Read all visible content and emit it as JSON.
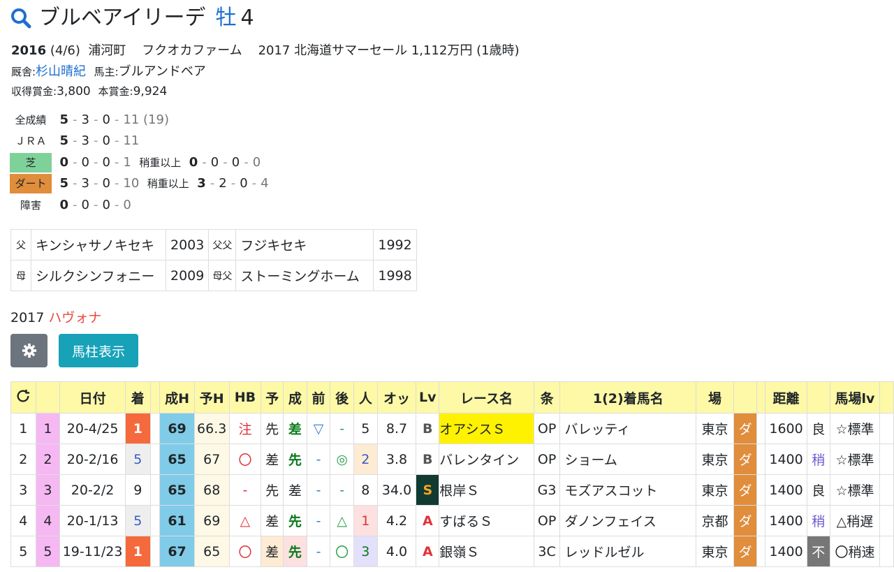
{
  "horse": {
    "name": "ブルベアイリーデ",
    "sex": "牡",
    "age": "4",
    "birth_year": "2016",
    "birth_date": "(4/6)",
    "region": "浦河町",
    "breeder": "フクオカファーム",
    "sale": "2017 北海道サマーセール 1,112万円 (1歳時)",
    "trainer_label": "厩舎:",
    "trainer": "杉山晴紀",
    "owner_label": "馬主:",
    "owner": "ブルアンドベア",
    "earn_label": "収得賞金:",
    "earn": "3,800",
    "prize_label": "本賞金:",
    "prize": "9,924"
  },
  "records": [
    {
      "label": "全成績",
      "a": "5",
      "b": "3",
      "c": "0",
      "d": "11",
      "extra": "(19)",
      "heavy_label": "",
      "ha": "",
      "hb": "",
      "hc": "",
      "hd": ""
    },
    {
      "label": "ＪＲＡ",
      "a": "5",
      "b": "3",
      "c": "0",
      "d": "11",
      "extra": "",
      "heavy_label": "",
      "ha": "",
      "hb": "",
      "hc": "",
      "hd": ""
    },
    {
      "label": "芝",
      "a": "0",
      "b": "0",
      "c": "0",
      "d": "1",
      "extra": "",
      "heavy_label": "稍重以上",
      "ha": "0",
      "hb": "0",
      "hc": "0",
      "hd": "0"
    },
    {
      "label": "ダート",
      "a": "5",
      "b": "3",
      "c": "0",
      "d": "10",
      "extra": "",
      "heavy_label": "稍重以上",
      "ha": "3",
      "hb": "2",
      "hc": "0",
      "hd": "4"
    },
    {
      "label": "障害",
      "a": "0",
      "b": "0",
      "c": "0",
      "d": "0",
      "extra": "",
      "heavy_label": "",
      "ha": "",
      "hb": "",
      "hc": "",
      "hd": ""
    }
  ],
  "pedigree": {
    "sire_k": "父",
    "sire": "キンシャサノキセキ",
    "sire_y": "2003",
    "ss_k": "父父",
    "ss": "フジキセキ",
    "ss_y": "1992",
    "dam_k": "母",
    "dam": "シルクシンフォニー",
    "dam_y": "2009",
    "ds_k": "母父",
    "ds": "ストーミングホーム",
    "ds_y": "1998"
  },
  "progeny": {
    "year": "2017",
    "name": "ハヴォナ"
  },
  "buttons": {
    "column_view": "馬柱表示"
  },
  "table": {
    "headers": [
      "",
      "",
      "日付",
      "着",
      "",
      "成H",
      "予H",
      "HB",
      "予",
      "成",
      "前",
      "後",
      "人",
      "オッ",
      "Lv",
      "レース名",
      "条",
      "1(2)着馬名",
      "場",
      "",
      "",
      "距離",
      "",
      "馬場lv",
      ""
    ],
    "rows": [
      {
        "no": "1",
        "wk": "1",
        "date": "20-4/25",
        "rank": "1",
        "sh": "69",
        "yh": "66.3",
        "hb": "注",
        "yo": "先",
        "sei": "差",
        "mae": "▽",
        "ato": "-",
        "pop": "5",
        "odds": "8.7",
        "lv": "B",
        "race": "オアシスＳ",
        "cls": "OP",
        "winner": "バレッティ",
        "venue": "東京",
        "surf": "ダ",
        "dist": "1600",
        "going": "良",
        "blv": "☆標準"
      },
      {
        "no": "2",
        "wk": "2",
        "date": "20-2/16",
        "rank": "5",
        "sh": "65",
        "yh": "67",
        "hb": "〇",
        "yo": "差",
        "sei": "先",
        "mae": "-",
        "ato": "◎",
        "pop": "2",
        "odds": "3.8",
        "lv": "B",
        "race": "バレンタイン",
        "cls": "OP",
        "winner": "ショーム",
        "venue": "東京",
        "surf": "ダ",
        "dist": "1400",
        "going": "稍",
        "blv": "☆標準"
      },
      {
        "no": "3",
        "wk": "3",
        "date": "20-2/2",
        "rank": "9",
        "sh": "65",
        "yh": "68",
        "hb": "-",
        "yo": "先",
        "sei": "差",
        "mae": "-",
        "ato": "-",
        "pop": "8",
        "odds": "34.0",
        "lv": "S",
        "race": "根岸Ｓ",
        "cls": "G3",
        "winner": "モズアスコット",
        "venue": "東京",
        "surf": "ダ",
        "dist": "1400",
        "going": "良",
        "blv": "☆標準"
      },
      {
        "no": "4",
        "wk": "4",
        "date": "20-1/13",
        "rank": "5",
        "sh": "61",
        "yh": "69",
        "hb": "△",
        "yo": "差",
        "sei": "先",
        "mae": "-",
        "ato": "△",
        "pop": "1",
        "odds": "4.2",
        "lv": "A",
        "race": "すばるＳ",
        "cls": "OP",
        "winner": "ダノンフェイス",
        "venue": "京都",
        "surf": "ダ",
        "dist": "1400",
        "going": "稍",
        "blv": "△稍遅"
      },
      {
        "no": "5",
        "wk": "5",
        "date": "19-11/23",
        "rank": "1",
        "sh": "67",
        "yh": "65",
        "hb": "〇",
        "yo": "差",
        "sei": "先",
        "mae": "-",
        "ato": "〇",
        "pop": "3",
        "odds": "4.0",
        "lv": "A",
        "race": "銀嶺Ｓ",
        "cls": "3C",
        "winner": "レッドルゼル",
        "venue": "東京",
        "surf": "ダ",
        "dist": "1400",
        "going": "不",
        "blv": "〇稍速"
      }
    ]
  },
  "colors": {
    "accent_blue": "#1e6fd0",
    "header_yellow": "#fdf9a6",
    "teal_button": "#17a2b8"
  }
}
